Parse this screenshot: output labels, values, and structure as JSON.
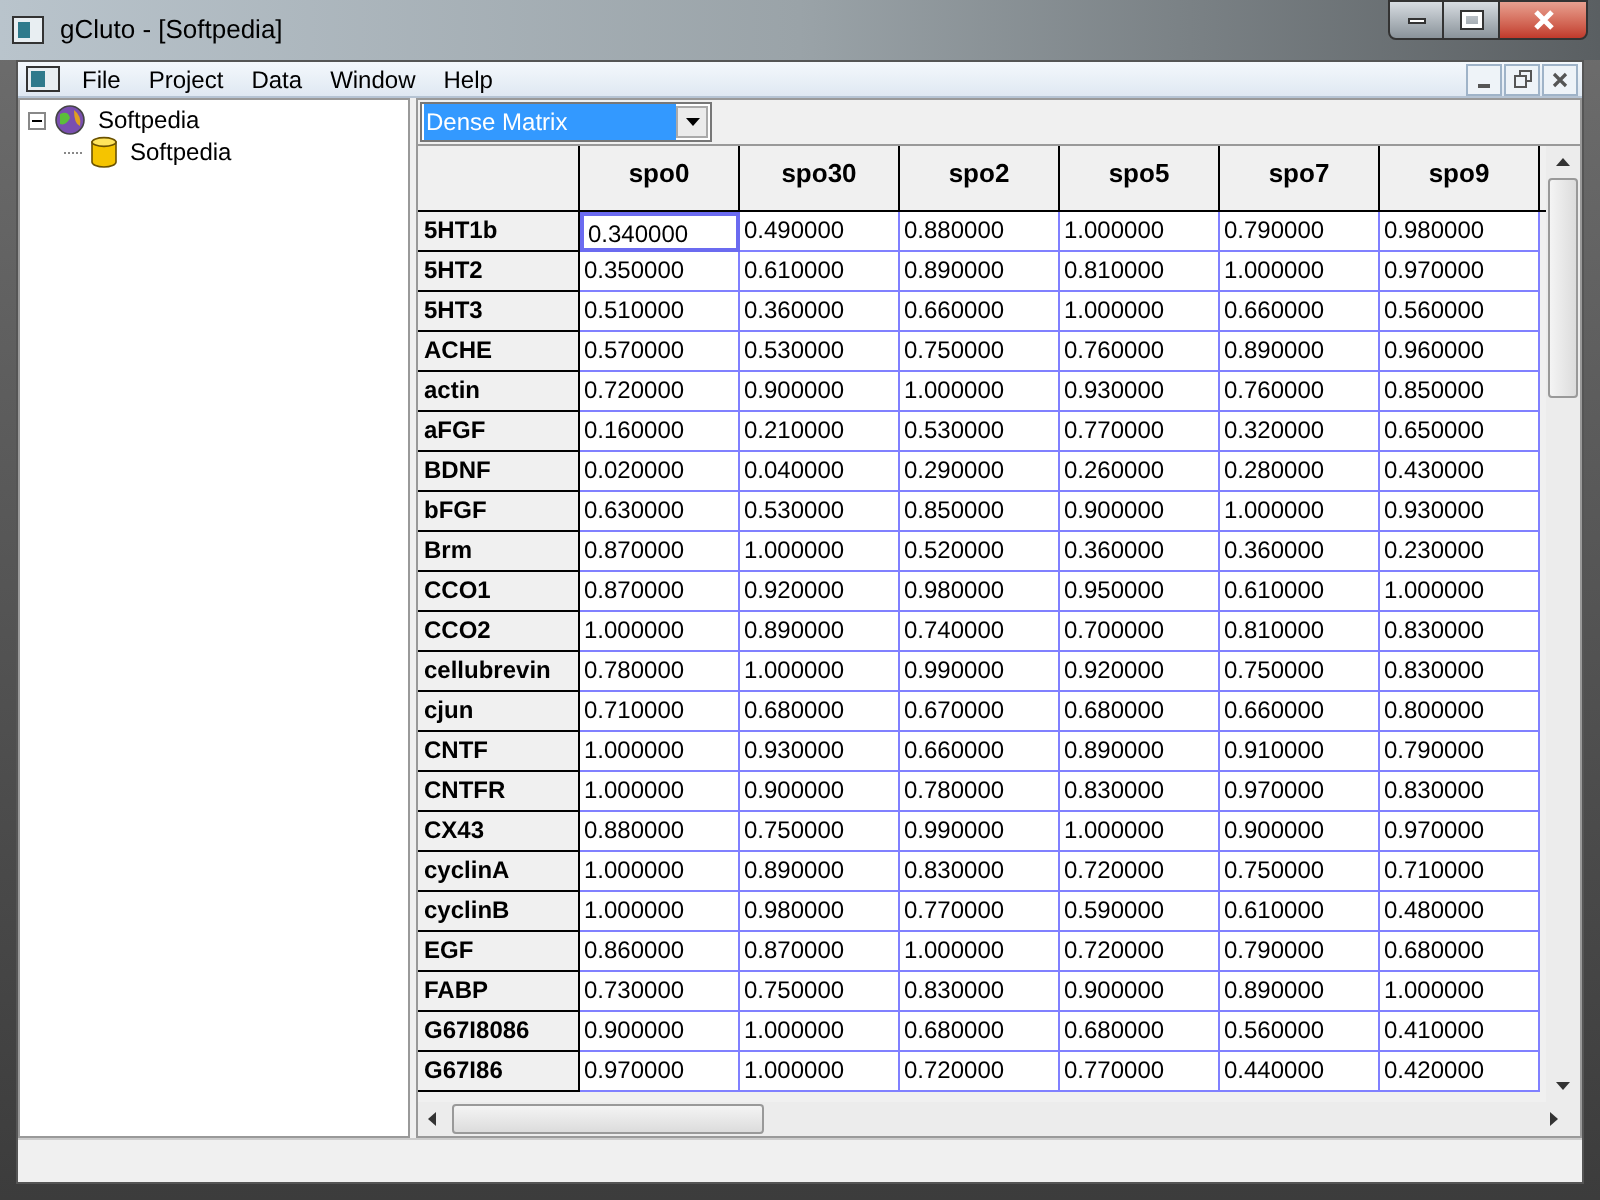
{
  "window": {
    "title": "gCluto - [Softpedia]"
  },
  "menu": [
    "File",
    "Project",
    "Data",
    "Window",
    "Help"
  ],
  "tree": [
    {
      "label": "Softpedia",
      "kind": "project",
      "expanded": true,
      "children": [
        {
          "label": "Softpedia",
          "kind": "dataset"
        }
      ]
    }
  ],
  "view_select": {
    "value": "Dense Matrix",
    "focused": true
  },
  "table": {
    "columns": [
      "spo0",
      "spo30",
      "spo2",
      "spo5",
      "spo7",
      "spo9"
    ],
    "rows": [
      {
        "label": "5HT1b",
        "cells": [
          {
            "text": "0.340000",
            "selected": true
          },
          {
            "text": "0.490000",
            "selected": false
          },
          {
            "text": "0.880000",
            "selected": false
          },
          {
            "text": "1.000000",
            "selected": false
          },
          {
            "text": "0.790000",
            "selected": false
          },
          {
            "text": "0.980000",
            "selected": false
          }
        ]
      },
      {
        "label": "5HT2",
        "cells": [
          {
            "text": "0.350000",
            "selected": false
          },
          {
            "text": "0.610000",
            "selected": false
          },
          {
            "text": "0.890000",
            "selected": false
          },
          {
            "text": "0.810000",
            "selected": false
          },
          {
            "text": "1.000000",
            "selected": false
          },
          {
            "text": "0.970000",
            "selected": false
          }
        ]
      },
      {
        "label": "5HT3",
        "cells": [
          {
            "text": "0.510000",
            "selected": false
          },
          {
            "text": "0.360000",
            "selected": false
          },
          {
            "text": "0.660000",
            "selected": false
          },
          {
            "text": "1.000000",
            "selected": false
          },
          {
            "text": "0.660000",
            "selected": false
          },
          {
            "text": "0.560000",
            "selected": false
          }
        ]
      },
      {
        "label": "ACHE",
        "cells": [
          {
            "text": "0.570000",
            "selected": false
          },
          {
            "text": "0.530000",
            "selected": false
          },
          {
            "text": "0.750000",
            "selected": false
          },
          {
            "text": "0.760000",
            "selected": false
          },
          {
            "text": "0.890000",
            "selected": false
          },
          {
            "text": "0.960000",
            "selected": false
          }
        ]
      },
      {
        "label": "actin",
        "cells": [
          {
            "text": "0.720000",
            "selected": false
          },
          {
            "text": "0.900000",
            "selected": false
          },
          {
            "text": "1.000000",
            "selected": false
          },
          {
            "text": "0.930000",
            "selected": false
          },
          {
            "text": "0.760000",
            "selected": false
          },
          {
            "text": "0.850000",
            "selected": false
          }
        ]
      },
      {
        "label": "aFGF",
        "cells": [
          {
            "text": "0.160000",
            "selected": false
          },
          {
            "text": "0.210000",
            "selected": false
          },
          {
            "text": "0.530000",
            "selected": false
          },
          {
            "text": "0.770000",
            "selected": false
          },
          {
            "text": "0.320000",
            "selected": false
          },
          {
            "text": "0.650000",
            "selected": false
          }
        ]
      },
      {
        "label": "BDNF",
        "cells": [
          {
            "text": "0.020000",
            "selected": false
          },
          {
            "text": "0.040000",
            "selected": false
          },
          {
            "text": "0.290000",
            "selected": false
          },
          {
            "text": "0.260000",
            "selected": false
          },
          {
            "text": "0.280000",
            "selected": false
          },
          {
            "text": "0.430000",
            "selected": false
          }
        ]
      },
      {
        "label": "bFGF",
        "cells": [
          {
            "text": "0.630000",
            "selected": false
          },
          {
            "text": "0.530000",
            "selected": false
          },
          {
            "text": "0.850000",
            "selected": false
          },
          {
            "text": "0.900000",
            "selected": false
          },
          {
            "text": "1.000000",
            "selected": false
          },
          {
            "text": "0.930000",
            "selected": false
          }
        ]
      },
      {
        "label": "Brm",
        "cells": [
          {
            "text": "0.870000",
            "selected": false
          },
          {
            "text": "1.000000",
            "selected": false
          },
          {
            "text": "0.520000",
            "selected": false
          },
          {
            "text": "0.360000",
            "selected": false
          },
          {
            "text": "0.360000",
            "selected": false
          },
          {
            "text": "0.230000",
            "selected": false
          }
        ]
      },
      {
        "label": "CCO1",
        "cells": [
          {
            "text": "0.870000",
            "selected": false
          },
          {
            "text": "0.920000",
            "selected": false
          },
          {
            "text": "0.980000",
            "selected": false
          },
          {
            "text": "0.950000",
            "selected": false
          },
          {
            "text": "0.610000",
            "selected": false
          },
          {
            "text": "1.000000",
            "selected": false
          }
        ]
      },
      {
        "label": "CCO2",
        "cells": [
          {
            "text": "1.000000",
            "selected": false
          },
          {
            "text": "0.890000",
            "selected": false
          },
          {
            "text": "0.740000",
            "selected": false
          },
          {
            "text": "0.700000",
            "selected": false
          },
          {
            "text": "0.810000",
            "selected": false
          },
          {
            "text": "0.830000",
            "selected": false
          }
        ]
      },
      {
        "label": "cellubrevin",
        "cells": [
          {
            "text": "0.780000",
            "selected": false
          },
          {
            "text": "1.000000",
            "selected": false
          },
          {
            "text": "0.990000",
            "selected": false
          },
          {
            "text": "0.920000",
            "selected": false
          },
          {
            "text": "0.750000",
            "selected": false
          },
          {
            "text": "0.830000",
            "selected": false
          }
        ]
      },
      {
        "label": "cjun",
        "cells": [
          {
            "text": "0.710000",
            "selected": false
          },
          {
            "text": "0.680000",
            "selected": false
          },
          {
            "text": "0.670000",
            "selected": false
          },
          {
            "text": "0.680000",
            "selected": false
          },
          {
            "text": "0.660000",
            "selected": false
          },
          {
            "text": "0.800000",
            "selected": false
          }
        ]
      },
      {
        "label": "CNTF",
        "cells": [
          {
            "text": "1.000000",
            "selected": false
          },
          {
            "text": "0.930000",
            "selected": false
          },
          {
            "text": "0.660000",
            "selected": false
          },
          {
            "text": "0.890000",
            "selected": false
          },
          {
            "text": "0.910000",
            "selected": false
          },
          {
            "text": "0.790000",
            "selected": false
          }
        ]
      },
      {
        "label": "CNTFR",
        "cells": [
          {
            "text": "1.000000",
            "selected": false
          },
          {
            "text": "0.900000",
            "selected": false
          },
          {
            "text": "0.780000",
            "selected": false
          },
          {
            "text": "0.830000",
            "selected": false
          },
          {
            "text": "0.970000",
            "selected": false
          },
          {
            "text": "0.830000",
            "selected": false
          }
        ]
      },
      {
        "label": "CX43",
        "cells": [
          {
            "text": "0.880000",
            "selected": false
          },
          {
            "text": "0.750000",
            "selected": false
          },
          {
            "text": "0.990000",
            "selected": false
          },
          {
            "text": "1.000000",
            "selected": false
          },
          {
            "text": "0.900000",
            "selected": false
          },
          {
            "text": "0.970000",
            "selected": false
          }
        ]
      },
      {
        "label": "cyclinA",
        "cells": [
          {
            "text": "1.000000",
            "selected": false
          },
          {
            "text": "0.890000",
            "selected": false
          },
          {
            "text": "0.830000",
            "selected": false
          },
          {
            "text": "0.720000",
            "selected": false
          },
          {
            "text": "0.750000",
            "selected": false
          },
          {
            "text": "0.710000",
            "selected": false
          }
        ]
      },
      {
        "label": "cyclinB",
        "cells": [
          {
            "text": "1.000000",
            "selected": false
          },
          {
            "text": "0.980000",
            "selected": false
          },
          {
            "text": "0.770000",
            "selected": false
          },
          {
            "text": "0.590000",
            "selected": false
          },
          {
            "text": "0.610000",
            "selected": false
          },
          {
            "text": "0.480000",
            "selected": false
          }
        ]
      },
      {
        "label": "EGF",
        "cells": [
          {
            "text": "0.860000",
            "selected": false
          },
          {
            "text": "0.870000",
            "selected": false
          },
          {
            "text": "1.000000",
            "selected": false
          },
          {
            "text": "0.720000",
            "selected": false
          },
          {
            "text": "0.790000",
            "selected": false
          },
          {
            "text": "0.680000",
            "selected": false
          }
        ]
      },
      {
        "label": "FABP",
        "cells": [
          {
            "text": "0.730000",
            "selected": false
          },
          {
            "text": "0.750000",
            "selected": false
          },
          {
            "text": "0.830000",
            "selected": false
          },
          {
            "text": "0.900000",
            "selected": false
          },
          {
            "text": "0.890000",
            "selected": false
          },
          {
            "text": "1.000000",
            "selected": false
          }
        ]
      },
      {
        "label": "G67I8086",
        "cells": [
          {
            "text": "0.900000",
            "selected": false
          },
          {
            "text": "1.000000",
            "selected": false
          },
          {
            "text": "0.680000",
            "selected": false
          },
          {
            "text": "0.680000",
            "selected": false
          },
          {
            "text": "0.560000",
            "selected": false
          },
          {
            "text": "0.410000",
            "selected": false
          }
        ]
      },
      {
        "label": "G67I86",
        "cells": [
          {
            "text": "0.970000",
            "selected": false
          },
          {
            "text": "1.000000",
            "selected": false
          },
          {
            "text": "0.720000",
            "selected": false
          },
          {
            "text": "0.770000",
            "selected": false
          },
          {
            "text": "0.440000",
            "selected": false
          },
          {
            "text": "0.420000",
            "selected": false
          }
        ]
      }
    ]
  }
}
